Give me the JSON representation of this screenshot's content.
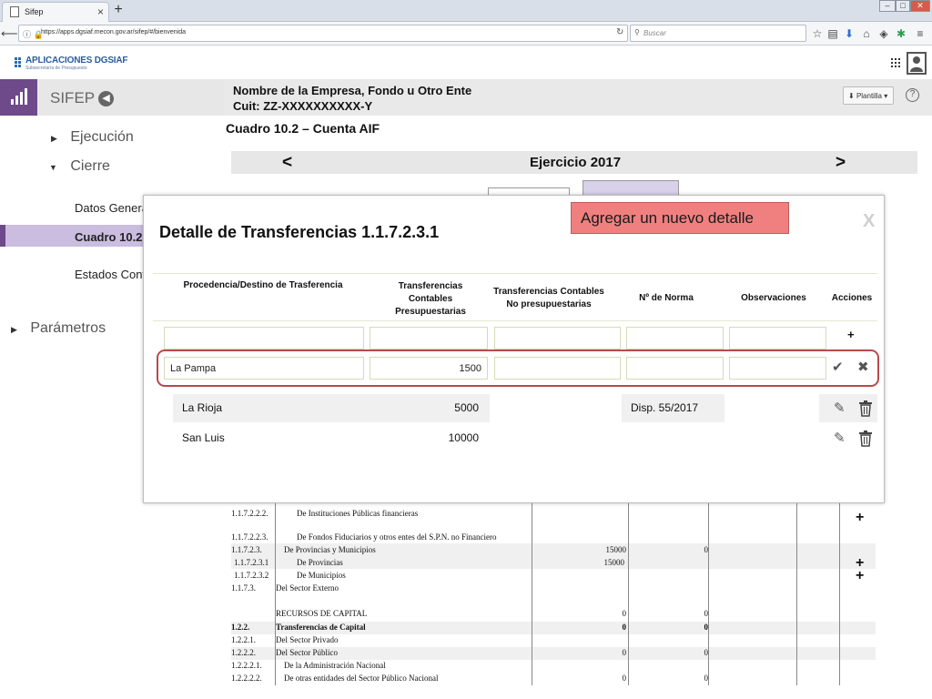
{
  "browser": {
    "tab_title": "Sifep",
    "tab_close": "×",
    "new_tab": "+",
    "url": "https://apps.dgsiaf.mecon.gov.ar/sifep/#/bienvenida",
    "search_placeholder": "Buscar"
  },
  "app": {
    "logo_title": "APLICACIONES DGSIAF",
    "logo_subtitle": "Subsecretaría de Presupuesto"
  },
  "sidebar": {
    "title": "SIFEP",
    "menu": [
      {
        "label": "Ejecución"
      },
      {
        "label": "Cierre"
      },
      {
        "label": "Parámetros"
      }
    ],
    "subitems": [
      {
        "label": "Datos Genera"
      },
      {
        "label": "Cuadro 10.2"
      },
      {
        "label": "Estados Cont"
      }
    ]
  },
  "header": {
    "company": "Nombre de la Empresa, Fondo u Otro Ente",
    "cuit": "Cuit: ZZ-XXXXXXXXXX-Y",
    "plantilla": "Plantilla",
    "help": "?"
  },
  "page": {
    "cuadro_title": "Cuadro 10.2  – Cuenta AIF",
    "ejercicio": "Ejercicio 2017",
    "prev": "<",
    "next": ">"
  },
  "background_table": {
    "rows": [
      {
        "code": "1.1.7.2.2.2.",
        "desc": "De Instituciones Públicas financieras",
        "v1": "",
        "v2": ""
      },
      {
        "code": "1.1.7.2.2.3.",
        "desc": "De Fondos Fiduciarios y otros entes del S.P.N. no Financiero",
        "v1": "",
        "v2": ""
      },
      {
        "code": "1.1.7.2.3.",
        "desc": "De Provincias y Municipios",
        "v1": "15000",
        "v2": "0"
      },
      {
        "code": "1.1.7.2.3.1",
        "desc": "De Provincias",
        "v1": "15000",
        "v2": ""
      },
      {
        "code": "1.1.7.2.3.2",
        "desc": "De Municipios",
        "v1": "",
        "v2": ""
      },
      {
        "code": "1.1.7.3.",
        "desc": "Del Sector Externo",
        "v1": "",
        "v2": ""
      },
      {
        "code": "",
        "desc": "RECURSOS DE CAPITAL",
        "v1": "0",
        "v2": "0"
      },
      {
        "code": "1.2.2.",
        "desc": "Transferencias de Capital",
        "v1": "0",
        "v2": "0"
      },
      {
        "code": "1.2.2.1.",
        "desc": "Del Sector Privado",
        "v1": "",
        "v2": ""
      },
      {
        "code": "1.2.2.2.",
        "desc": "Del Sector Público",
        "v1": "0",
        "v2": "0"
      },
      {
        "code": "1.2.2.2.1.",
        "desc": "De la Administración Nacional",
        "v1": "",
        "v2": ""
      },
      {
        "code": "1.2.2.2.2.",
        "desc": "De otras entidades del Sector Público Nacional",
        "v1": "0",
        "v2": "0"
      }
    ],
    "plus": "+"
  },
  "modal": {
    "title": "Detalle de Transferencias 1.1.7.2.3.1",
    "close": "X",
    "callout": "Agregar un nuevo detalle",
    "columns": {
      "c1": "Procedencia/Destino de Trasferencia",
      "c2": "Transferencias Contables Presupuestarias",
      "c3": "Transferencias Contables No presupuestarias",
      "c4": "Nº de Norma",
      "c5": "Observaciones",
      "c6": "Acciones"
    },
    "add_symbol": "+",
    "editing_row": {
      "procedencia": "La Pampa",
      "presupuestarias": "1500",
      "no_presupuestarias": "",
      "norma": "",
      "observaciones": ""
    },
    "confirm_symbol": "✔",
    "cancel_symbol": "✖",
    "rows": [
      {
        "procedencia": "La Rioja",
        "presupuestarias": "5000",
        "no_presupuestarias": "",
        "norma": "Disp. 55/2017",
        "observaciones": ""
      },
      {
        "procedencia": "San Luis",
        "presupuestarias": "10000",
        "no_presupuestarias": "",
        "norma": "",
        "observaciones": ""
      }
    ]
  }
}
